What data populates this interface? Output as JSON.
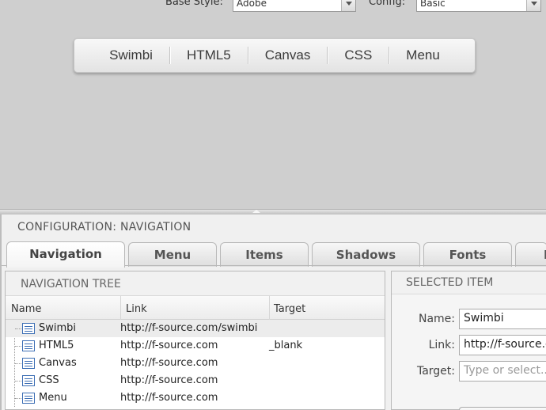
{
  "top_bar": {
    "base_style_label": "Base Style:",
    "base_style_value": "Adobe",
    "config_label": "Config:",
    "config_value": "Basic"
  },
  "preview_nav": {
    "items": [
      "Swimbi",
      "HTML5",
      "Canvas",
      "CSS",
      "Menu"
    ]
  },
  "config": {
    "title": "CONFIGURATION: NAVIGATION",
    "tabs": [
      "Navigation",
      "Menu",
      "Items",
      "Shadows",
      "Fonts",
      "P"
    ],
    "active_tab": "Navigation"
  },
  "tree": {
    "title": "NAVIGATION TREE",
    "columns": [
      "Name",
      "Link",
      "Target"
    ],
    "rows": [
      {
        "name": "Swimbi",
        "link": "http://f-source.com/swimbi",
        "target": "",
        "selected": true
      },
      {
        "name": "HTML5",
        "link": "http://f-source.com",
        "target": "_blank",
        "selected": false
      },
      {
        "name": "Canvas",
        "link": "http://f-source.com",
        "target": "",
        "selected": false
      },
      {
        "name": "CSS",
        "link": "http://f-source.com",
        "target": "",
        "selected": false
      },
      {
        "name": "Menu",
        "link": "http://f-source.com",
        "target": "",
        "selected": false
      }
    ]
  },
  "selected_item": {
    "title": "SELECTED ITEM",
    "name_label": "Name:",
    "name_value": "Swimbi",
    "link_label": "Link:",
    "link_value": "http://f-source.com/swimbi",
    "target_label": "Target:",
    "target_placeholder": "Type or select..."
  }
}
